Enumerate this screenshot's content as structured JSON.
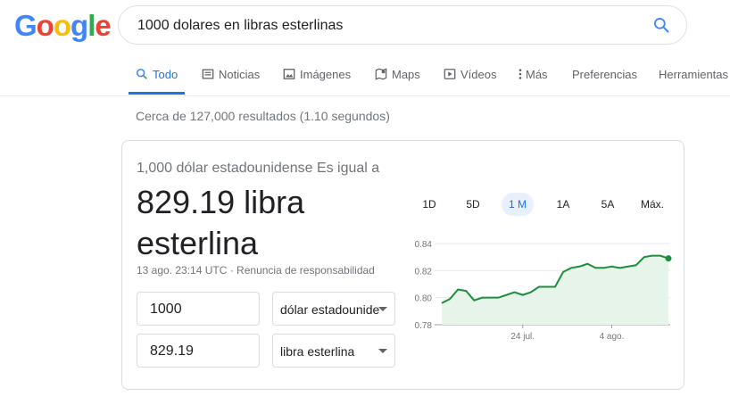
{
  "logo": [
    "G",
    "o",
    "o",
    "g",
    "l",
    "e"
  ],
  "search": {
    "query": "1000 dolares en libras esterlinas"
  },
  "tabs": [
    {
      "label": "Todo",
      "icon": "search-icon"
    },
    {
      "label": "Noticias",
      "icon": "news-icon"
    },
    {
      "label": "Imágenes",
      "icon": "image-icon"
    },
    {
      "label": "Maps",
      "icon": "map-icon"
    },
    {
      "label": "Vídeos",
      "icon": "video-icon"
    },
    {
      "label": "Más",
      "icon": "more-icon"
    },
    {
      "label": "Preferencias"
    },
    {
      "label": "Herramientas"
    }
  ],
  "stats": "Cerca de 127,000 resultados (1.10 segundos)",
  "converter": {
    "equals_text": "1,000 dólar estadounidense Es igual a",
    "result_line1": "829.19 libra",
    "result_line2": "esterlina",
    "meta": "13 ago. 23:14 UTC · Renuncia de responsabilidad",
    "from_value": "1000",
    "from_currency": "dólar estadounidense",
    "to_value": "829.19",
    "to_currency": "libra esterlina",
    "ranges": [
      "1D",
      "5D",
      "1 M",
      "1A",
      "5A",
      "Máx."
    ],
    "active_range": "1 M"
  },
  "chart_data": {
    "type": "area",
    "y_ticks": [
      "0.84",
      "0.82",
      "0.80",
      "0.78"
    ],
    "ylim": [
      0.78,
      0.84
    ],
    "x_ticks": [
      {
        "label": "24 jul.",
        "index": 10
      },
      {
        "label": "4 ago.",
        "index": 21
      }
    ],
    "values": [
      0.796,
      0.799,
      0.806,
      0.805,
      0.798,
      0.8,
      0.8,
      0.8,
      0.802,
      0.804,
      0.802,
      0.804,
      0.808,
      0.808,
      0.808,
      0.819,
      0.822,
      0.823,
      0.825,
      0.822,
      0.822,
      0.823,
      0.822,
      0.823,
      0.824,
      0.83,
      0.831,
      0.831,
      0.829
    ],
    "color": "#1e8e3e",
    "fill": "#e6f4ea"
  }
}
